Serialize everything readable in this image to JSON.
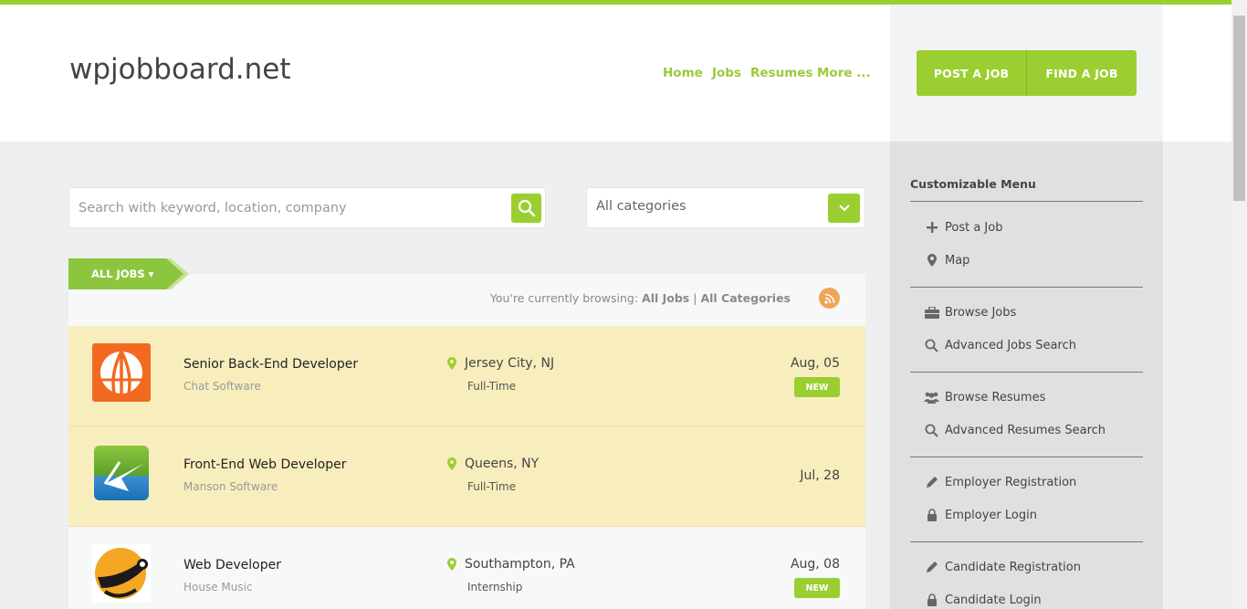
{
  "site": {
    "logo": "wpjobboard.net"
  },
  "nav": [
    {
      "label": "Home"
    },
    {
      "label": "Jobs"
    },
    {
      "label": "Resumes"
    },
    {
      "label": "More ..."
    }
  ],
  "cta": {
    "post_label": "POST A JOB",
    "find_label": "FIND A JOB"
  },
  "search": {
    "placeholder": "Search with keyword, location, company"
  },
  "category": {
    "value": "All categories"
  },
  "filter": {
    "ribbon_label": "ALL JOBS ▾",
    "browsing_prefix": "You're currently browsing:",
    "browsing_jobs": "All Jobs",
    "browsing_sep": "|",
    "browsing_cats": "All Categories"
  },
  "jobs": [
    {
      "title": "Senior Back-End Developer",
      "company": "Chat Software",
      "location": "Jersey City, NJ",
      "type": "Full-Time",
      "date": "Aug, 05",
      "badge": "NEW"
    },
    {
      "title": "Front-End Web Developer",
      "company": "Manson Software",
      "location": "Queens, NY",
      "type": "Full-Time",
      "date": "Jul, 28",
      "badge": ""
    },
    {
      "title": "Web Developer",
      "company": "House Music",
      "location": "Southampton, PA",
      "type": "Internship",
      "date": "Aug, 08",
      "badge": "NEW"
    }
  ],
  "sidebar": {
    "title": "Customizable Menu",
    "items": [
      {
        "label": "Post a Job",
        "icon": "plus-icon"
      },
      {
        "label": "Map",
        "icon": "map-pin-icon"
      },
      {
        "label": "Browse Jobs",
        "icon": "briefcase-icon"
      },
      {
        "label": "Advanced Jobs Search",
        "icon": "search-icon"
      },
      {
        "label": "Browse Resumes",
        "icon": "users-icon"
      },
      {
        "label": "Advanced Resumes Search",
        "icon": "search-icon"
      },
      {
        "label": "Employer Registration",
        "icon": "pencil-icon"
      },
      {
        "label": "Employer Login",
        "icon": "lock-icon"
      },
      {
        "label": "Candidate Registration",
        "icon": "pencil-icon"
      },
      {
        "label": "Candidate Login",
        "icon": "lock-icon"
      }
    ]
  },
  "colors": {
    "accent": "#9bce30",
    "featured": "#f8eebd",
    "rss": "#f0a656"
  }
}
